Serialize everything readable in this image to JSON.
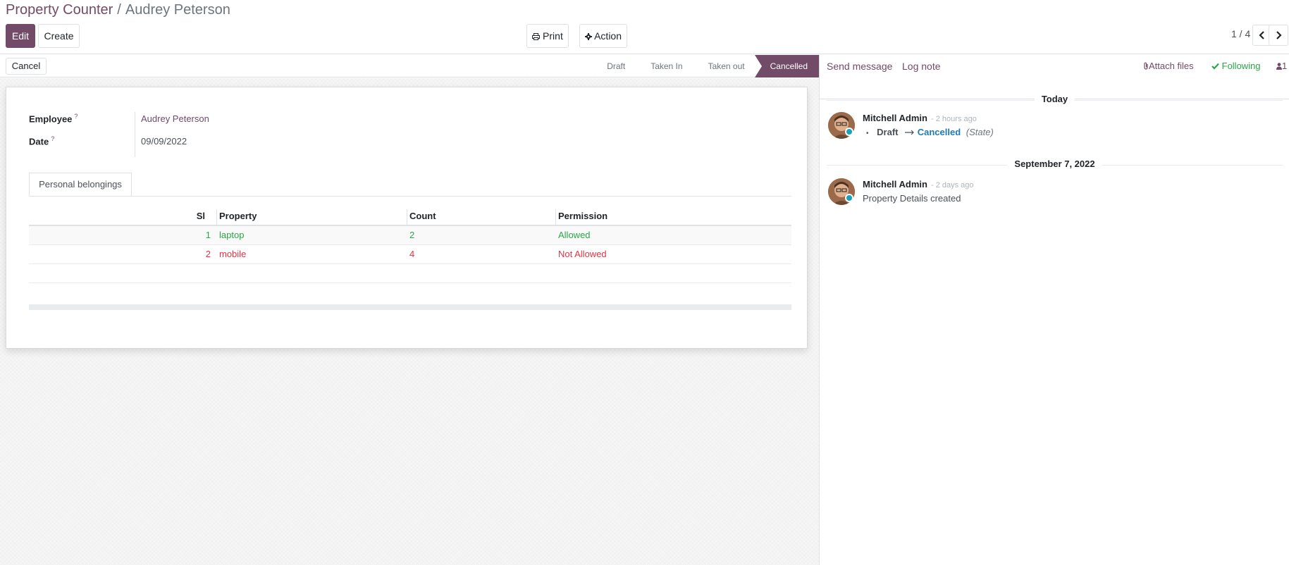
{
  "breadcrumb": {
    "parent": "Property Counter",
    "separator": "/",
    "current": "Audrey Peterson"
  },
  "toolbar": {
    "edit": "Edit",
    "create": "Create",
    "print": "Print",
    "action": "Action"
  },
  "pager": {
    "value": "1 / 4"
  },
  "statusbar": {
    "cancel": "Cancel",
    "steps": [
      "Draft",
      "Taken In",
      "Taken out",
      "Cancelled"
    ],
    "active_step": "Cancelled"
  },
  "form": {
    "employee_label": "Employee",
    "employee_value": "Audrey Peterson",
    "date_label": "Date",
    "date_value": "09/09/2022",
    "help_marker": "?"
  },
  "tab": {
    "label": "Personal belongings"
  },
  "table": {
    "headers": [
      "Sl",
      "Property",
      "Count",
      "Permission"
    ],
    "rows": [
      {
        "sl": "1",
        "property": "laptop",
        "count": "2",
        "permission": "Allowed"
      },
      {
        "sl": "2",
        "property": "mobile",
        "count": "4",
        "permission": "Not Allowed"
      }
    ]
  },
  "chatter": {
    "send_message": "Send message",
    "log_note": "Log note",
    "attach_files": "Attach files",
    "following": "Following",
    "followers_count": "1",
    "sections": [
      {
        "date": "Today",
        "author": "Mitchell Admin",
        "time": "- 2 hours ago",
        "from": "Draft",
        "to": "Cancelled",
        "field": "(State)"
      },
      {
        "date": "September 7, 2022",
        "author": "Mitchell Admin",
        "time": "- 2 days ago",
        "body": "Property Details created"
      }
    ]
  },
  "colors": {
    "brand": "#714B67",
    "allowed": "#28a745",
    "not_allowed": "#dc3545",
    "state_link": "#1c7ab4",
    "presence": "#17a2b8"
  }
}
